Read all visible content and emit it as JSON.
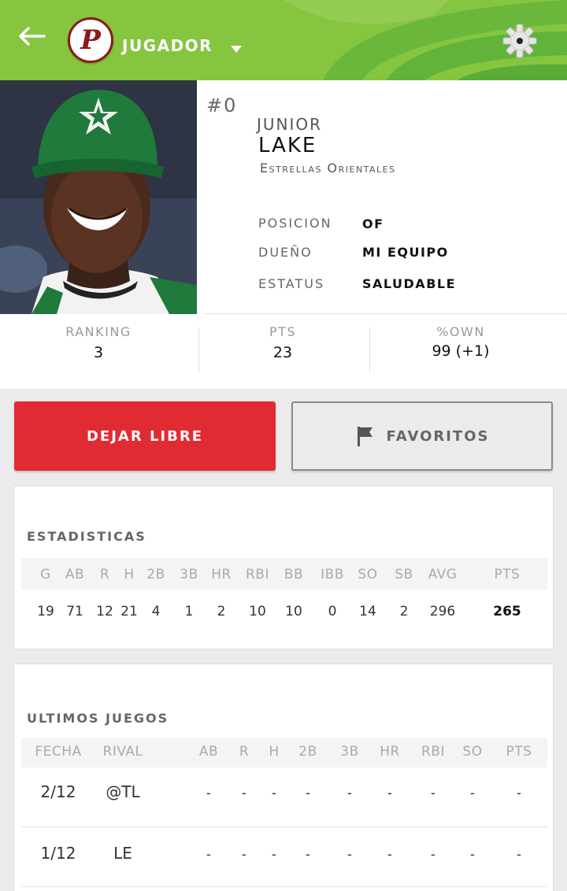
{
  "header": {
    "title": "JUGADOR",
    "logo_letter": "P",
    "back_icon": "arrow-left-icon",
    "settings_icon": "gear-icon",
    "caret_icon": "caret-down-icon"
  },
  "player": {
    "number": "#0",
    "first_name": "JUNIOR",
    "last_name": "LAKE",
    "team": "Estrellas Orientales",
    "info": [
      {
        "label": "POSICION",
        "value": "OF"
      },
      {
        "label": "DUEÑO",
        "value": "MI EQUIPO"
      },
      {
        "label": "ESTATUS",
        "value": "SALUDABLE"
      }
    ],
    "summary": [
      {
        "label": "RANKING",
        "value": "3"
      },
      {
        "label": "PTS",
        "value": "23"
      },
      {
        "label": "%OWN",
        "value": "99 (+1)"
      }
    ]
  },
  "actions": {
    "release_label": "DEJAR LIBRE",
    "favorites_label": "FAVORITOS",
    "favorites_icon": "flag-icon"
  },
  "stats": {
    "title": "ESTADISTICAS",
    "headers": [
      "G",
      "AB",
      "R",
      "H",
      "2B",
      "3B",
      "HR",
      "RBI",
      "BB",
      "IBB",
      "SO",
      "SB",
      "AVG",
      "PTS"
    ],
    "values": [
      "19",
      "71",
      "12",
      "21",
      "4",
      "1",
      "2",
      "10",
      "10",
      "0",
      "14",
      "2",
      "296",
      "265"
    ]
  },
  "games": {
    "title": "ULTIMOS JUEGOS",
    "headers": [
      "FECHA",
      "RIVAL",
      "AB",
      "R",
      "H",
      "2B",
      "3B",
      "HR",
      "RBI",
      "SO",
      "PTS"
    ],
    "rows": [
      [
        "2/12",
        "@TL",
        "-",
        "-",
        "-",
        "-",
        "-",
        "-",
        "-",
        "-",
        "-"
      ],
      [
        "1/12",
        "LE",
        "-",
        "-",
        "-",
        "-",
        "-",
        "-",
        "-",
        "-",
        "-"
      ]
    ]
  },
  "colors": {
    "header_green": "#86c540",
    "release_red": "#e12b33",
    "logo_maroon": "#8b1a1a"
  }
}
